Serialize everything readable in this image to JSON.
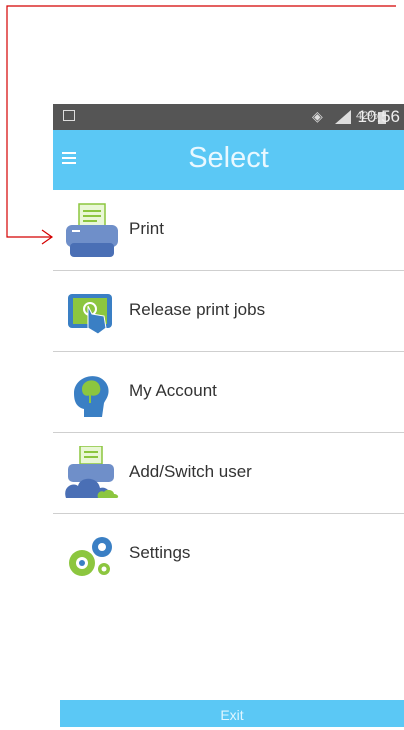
{
  "status_bar": {
    "battery_percent": "42%",
    "time": "10:56"
  },
  "header": {
    "title": "Select"
  },
  "menu": {
    "items": [
      {
        "label": "Print",
        "icon": "printer-icon"
      },
      {
        "label": "Release print jobs",
        "icon": "touch-screen-icon"
      },
      {
        "label": "My Account",
        "icon": "user-head-icon"
      },
      {
        "label": "Add/Switch user",
        "icon": "printer-cloud-icon"
      },
      {
        "label": "Settings",
        "icon": "gears-icon"
      }
    ]
  },
  "footer": {
    "exit_label": "Exit"
  },
  "colors": {
    "accent": "#5bc8f5",
    "annotation": "#d40000"
  }
}
